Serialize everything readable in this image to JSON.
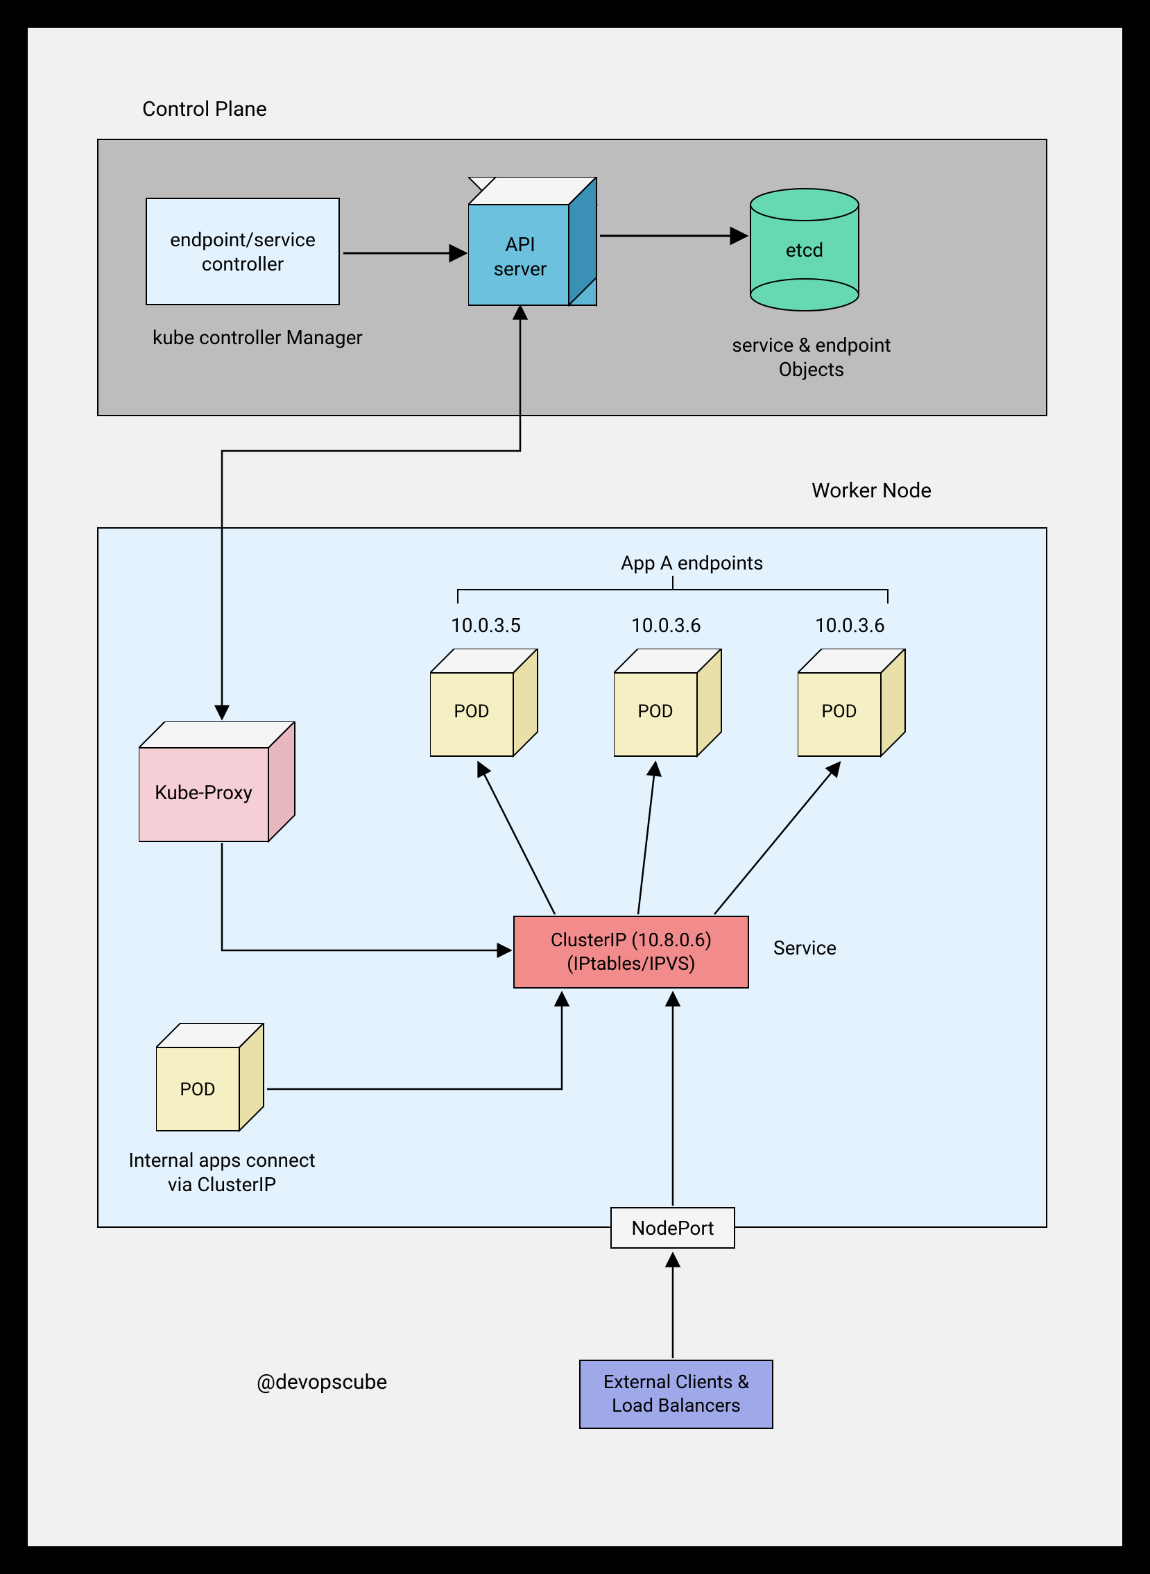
{
  "labels": {
    "controlPlane": "Control Plane",
    "kubeControllerManager": "kube controller Manager",
    "endpointServiceController": "endpoint/service\ncontroller",
    "apiServer": "API\nserver",
    "etcd": "etcd",
    "serviceEndpointObjects": "service & endpoint\nObjects",
    "workerNode": "Worker Node",
    "appAEndpoints": "App A endpoints",
    "podIp1": "10.0.3.5",
    "podIp2": "10.0.3.6",
    "podIp3": "10.0.3.6",
    "pod": "POD",
    "kubeProxy": "Kube-Proxy",
    "clusterIp": "ClusterIP (10.8.0.6)\n(IPtables/IPVS)",
    "service": "Service",
    "internalAppsConnect": "Internal apps connect\nvia ClusterIP",
    "nodePort": "NodePort",
    "externalClients": "External Clients &\nLoad Balancers",
    "watermark": "@devopscube"
  }
}
